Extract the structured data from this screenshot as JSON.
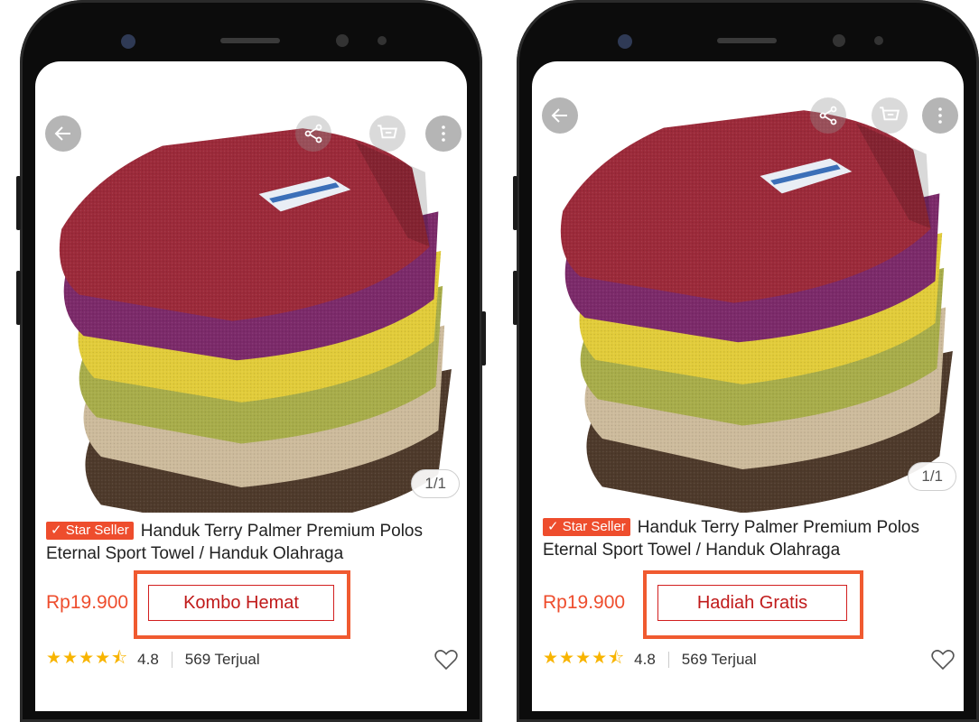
{
  "colors": {
    "accent": "#ee4d2d",
    "callout_border": "#f05a30",
    "callout_text": "#c01a1a",
    "star": "#f8b400"
  },
  "phones": [
    {
      "image_counter": "1/1",
      "badge": "Star Seller",
      "title": "Handuk Terry Palmer Premium Polos Eternal Sport Towel / Handuk Olahraga",
      "price": "Rp19.900",
      "rating": "4.8",
      "sold": "569 Terjual",
      "callout_label": "Kombo Hemat"
    },
    {
      "image_counter": "1/1",
      "badge": "Star Seller",
      "title": "Handuk Terry Palmer Premium Polos Eternal Sport Towel / Handuk Olahraga",
      "price": "Rp19.900",
      "rating": "4.8",
      "sold": "569 Terjual",
      "callout_label": "Hadiah Gratis"
    }
  ]
}
